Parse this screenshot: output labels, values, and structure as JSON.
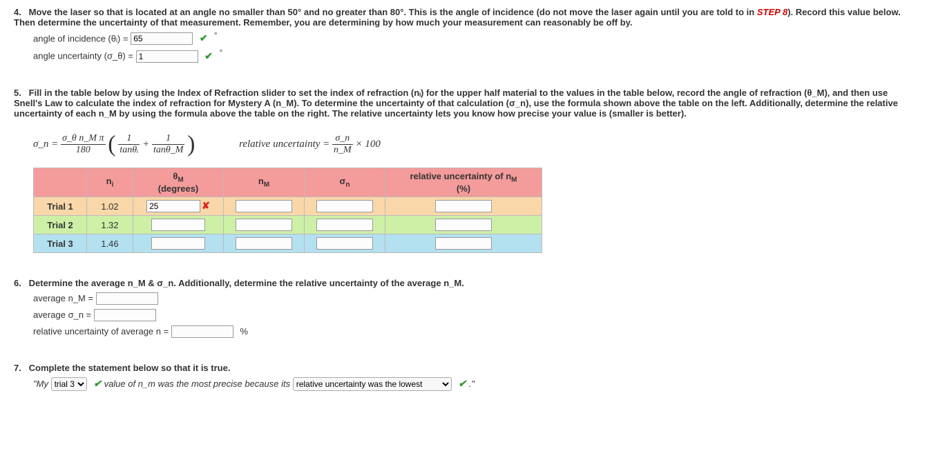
{
  "q4": {
    "number": "4.",
    "text_before_step8": "Move the laser so that is located at an angle no smaller than 50° and no greater than 80°. This is the angle of incidence (do not move the laser again until you are told to in ",
    "step8": "STEP 8",
    "text_after_step8": "). Record this value below. Then determine the uncertainty of that measurement. Remember, you are determining by how much your measurement can reasonably be off by.",
    "incidence_label": "angle of incidence (θᵢ) =",
    "incidence_value": "65",
    "uncertainty_label": "angle uncertainty (σ_θ) =",
    "uncertainty_value": "1",
    "deg_unit": "°"
  },
  "q5": {
    "number": "5.",
    "text": "Fill in the table below by using the Index of Refraction slider to set the index of refraction (nᵢ) for the upper half material to the values in the table below, record the angle of refraction (θ_M), and then use Snell's Law to calculate the index of refraction for Mystery A (n_M). To determine the uncertainty of that calculation (σ_n), use the formula shown above the table on the left. Additionally, determine the relative uncertainty of each n_M by using the formula above the table on the right. The relative uncertainty lets you know how precise your value is (smaller is better).",
    "formula1_left": "σ_n =",
    "formula1_num": "σ_θ n_M π",
    "formula1_den": "180",
    "formula1_inner_num1": "1",
    "formula1_inner_den1": "tanθᵢ",
    "formula1_plus": "+",
    "formula1_inner_num2": "1",
    "formula1_inner_den2": "tanθ_M",
    "formula2_left": "relative uncertainty =",
    "formula2_num": "σ_n",
    "formula2_den": "n_M",
    "formula2_tail": " × 100",
    "table": {
      "headers": [
        "",
        "nᵢ",
        "θ_M\n(degrees)",
        "n_M",
        "σ_n",
        "relative uncertainty of n_M\n(%)"
      ],
      "rows": [
        {
          "label": "Trial 1",
          "n_i": "1.02",
          "theta_m": "25",
          "theta_m_wrong": true
        },
        {
          "label": "Trial 2",
          "n_i": "1.32",
          "theta_m": ""
        },
        {
          "label": "Trial 3",
          "n_i": "1.46",
          "theta_m": ""
        }
      ]
    }
  },
  "q6": {
    "number": "6.",
    "text": "Determine the average n_M & σ_n. Additionally, determine the relative uncertainty of the average n_M.",
    "avg_nm": "average n_M =",
    "avg_sn": "average σ_n =",
    "rel_unc": "relative uncertainty of average n =",
    "pct": "%"
  },
  "q7": {
    "number": "7.",
    "text": "Complete the statement below so that it is true.",
    "quote_open": "\"My",
    "select1": "trial 3",
    "mid": "value of n_m was the most precise because its",
    "select2": "relative uncertainty was the lowest",
    "quote_close": ".\""
  },
  "chart_data": {
    "type": "table",
    "title": "Refraction trials",
    "columns": [
      "Trial",
      "n_i",
      "theta_M_deg",
      "n_M",
      "sigma_n",
      "relative_uncertainty_pct"
    ],
    "rows": [
      [
        "Trial 1",
        1.02,
        25,
        null,
        null,
        null
      ],
      [
        "Trial 2",
        1.32,
        null,
        null,
        null,
        null
      ],
      [
        "Trial 3",
        1.46,
        null,
        null,
        null,
        null
      ]
    ]
  }
}
